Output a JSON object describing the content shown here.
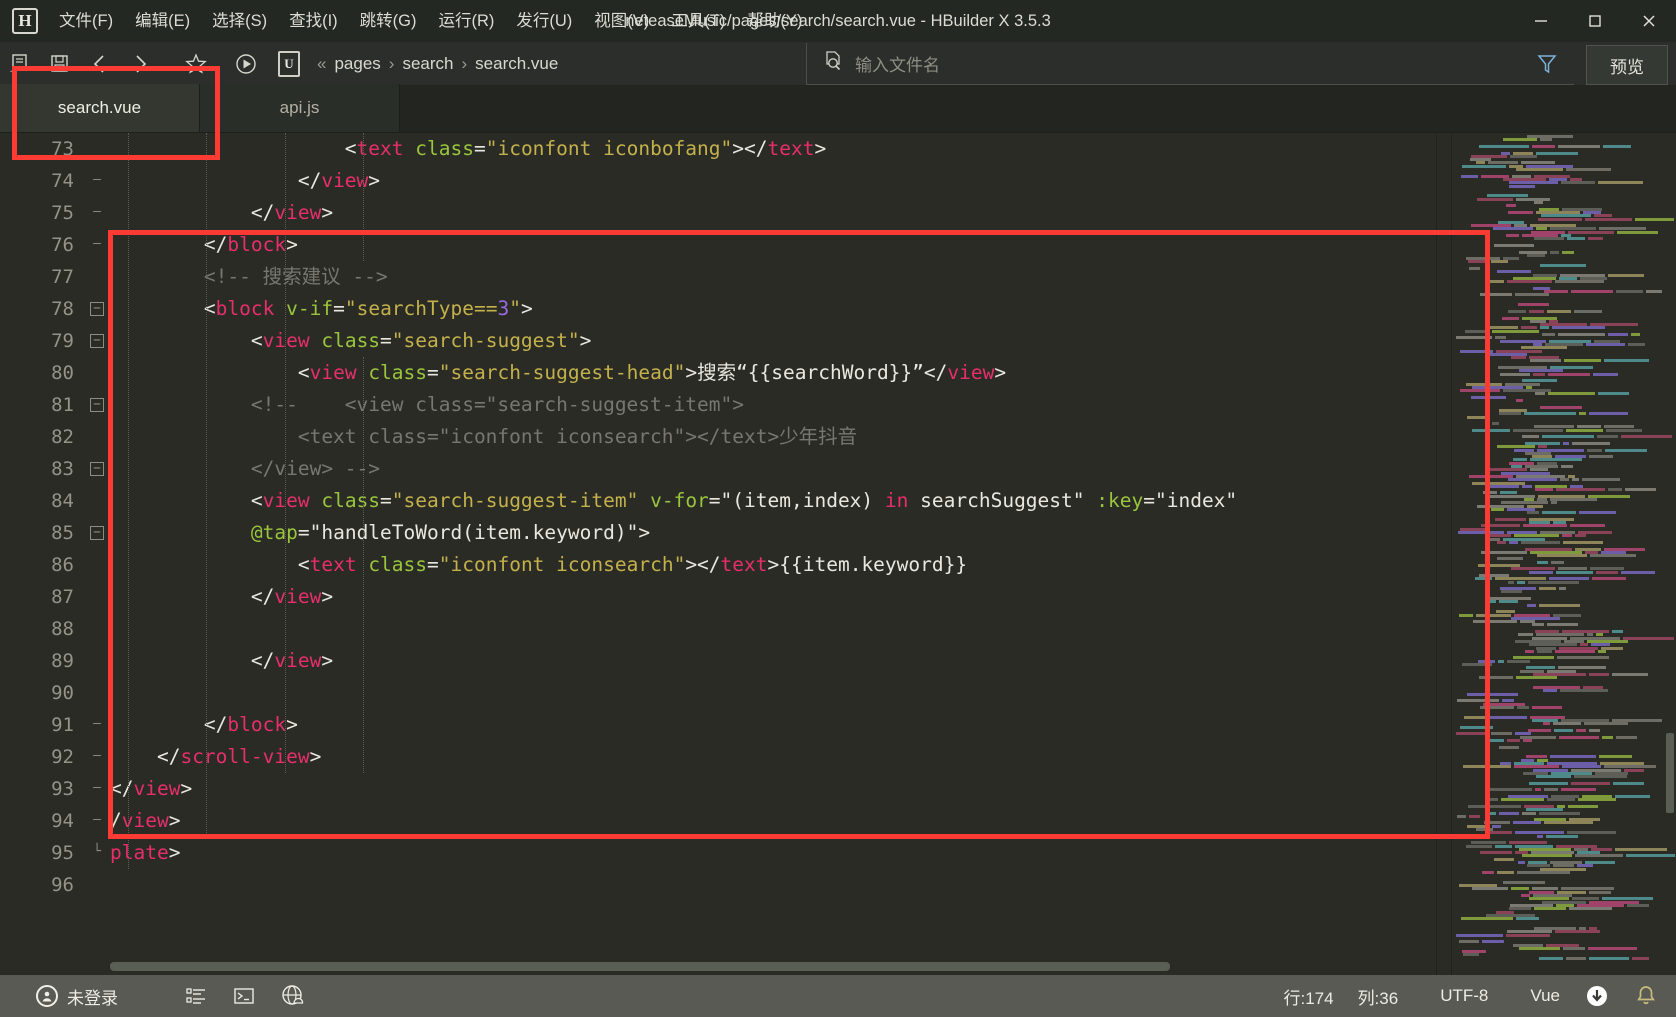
{
  "window": {
    "title": "neteaseMusic/pages/search/search.vue - HBuilder X 3.5.3",
    "logo_letter": "H",
    "minimize": "─",
    "maximize": "☐",
    "close": "✕"
  },
  "menubar": {
    "items": [
      {
        "label": "文件(F)",
        "name": "menu-file"
      },
      {
        "label": "编辑(E)",
        "name": "menu-edit"
      },
      {
        "label": "选择(S)",
        "name": "menu-select"
      },
      {
        "label": "查找(I)",
        "name": "menu-find"
      },
      {
        "label": "跳转(G)",
        "name": "menu-goto"
      },
      {
        "label": "运行(R)",
        "name": "menu-run"
      },
      {
        "label": "发行(U)",
        "name": "menu-publish"
      },
      {
        "label": "视图(V)",
        "name": "menu-view"
      },
      {
        "label": "工具(T)",
        "name": "menu-tools"
      },
      {
        "label": "帮助(Y)",
        "name": "menu-help"
      }
    ]
  },
  "toolbar": {
    "icons": [
      "new-file-icon",
      "save-icon",
      "back-arrow-icon",
      "forward-arrow-icon",
      "star-icon",
      "run-icon"
    ],
    "breadcrumb": {
      "project_logo": "U",
      "chevron": "«",
      "separator": "›",
      "items": [
        "pages",
        "search",
        "search.vue"
      ]
    },
    "file_search_placeholder": "输入文件名",
    "file_search_value": "",
    "preview_label": "预览"
  },
  "tabs": [
    {
      "label": "search.vue",
      "active": true
    },
    {
      "label": "api.js",
      "active": false
    }
  ],
  "editor": {
    "first_line": 73,
    "line_numbers": [
      73,
      74,
      75,
      76,
      77,
      78,
      79,
      80,
      81,
      82,
      83,
      84,
      85,
      86,
      87,
      88,
      89,
      90,
      91,
      92,
      93,
      94,
      95,
      96
    ],
    "lines": [
      {
        "n": 73,
        "fold": "",
        "indent": 0,
        "tokens": [
          {
            "t": "punc",
            "v": "                    <"
          },
          {
            "t": "tag",
            "v": "text"
          },
          {
            "t": "txt",
            "v": " "
          },
          {
            "t": "attr",
            "v": "class"
          },
          {
            "t": "punc",
            "v": "="
          },
          {
            "t": "str",
            "v": "\"iconfont iconbofang\""
          },
          {
            "t": "punc",
            "v": "></"
          },
          {
            "t": "tag",
            "v": "text"
          },
          {
            "t": "punc",
            "v": ">"
          }
        ]
      },
      {
        "n": 74,
        "fold": "dash",
        "indent": 0,
        "tokens": [
          {
            "t": "punc",
            "v": "                </"
          },
          {
            "t": "tag",
            "v": "view"
          },
          {
            "t": "punc",
            "v": ">"
          }
        ]
      },
      {
        "n": 75,
        "fold": "dash",
        "indent": 0,
        "tokens": [
          {
            "t": "punc",
            "v": "            </"
          },
          {
            "t": "tag",
            "v": "view"
          },
          {
            "t": "punc",
            "v": ">"
          }
        ]
      },
      {
        "n": 76,
        "fold": "dash",
        "indent": 0,
        "tokens": [
          {
            "t": "punc",
            "v": "        </"
          },
          {
            "t": "tag",
            "v": "block"
          },
          {
            "t": "punc",
            "v": ">"
          }
        ]
      },
      {
        "n": 77,
        "fold": "",
        "indent": 0,
        "tokens": [
          {
            "t": "cmt",
            "v": "        <!-- 搜索建议 -->"
          }
        ]
      },
      {
        "n": 78,
        "fold": "box",
        "indent": 0,
        "tokens": [
          {
            "t": "punc",
            "v": "        <"
          },
          {
            "t": "tag",
            "v": "block"
          },
          {
            "t": "txt",
            "v": " "
          },
          {
            "t": "attr",
            "v": "v-if"
          },
          {
            "t": "punc",
            "v": "="
          },
          {
            "t": "str",
            "v": "\"searchType=="
          },
          {
            "t": "num",
            "v": "3"
          },
          {
            "t": "str",
            "v": "\""
          },
          {
            "t": "punc",
            "v": ">"
          }
        ]
      },
      {
        "n": 79,
        "fold": "box",
        "indent": 0,
        "tokens": [
          {
            "t": "punc",
            "v": "            <"
          },
          {
            "t": "tag",
            "v": "view"
          },
          {
            "t": "txt",
            "v": " "
          },
          {
            "t": "attr",
            "v": "class"
          },
          {
            "t": "punc",
            "v": "="
          },
          {
            "t": "str",
            "v": "\"search-suggest\""
          },
          {
            "t": "punc",
            "v": ">"
          }
        ]
      },
      {
        "n": 80,
        "fold": "",
        "indent": 0,
        "tokens": [
          {
            "t": "punc",
            "v": "                <"
          },
          {
            "t": "tag",
            "v": "view"
          },
          {
            "t": "txt",
            "v": " "
          },
          {
            "t": "attr",
            "v": "class"
          },
          {
            "t": "punc",
            "v": "="
          },
          {
            "t": "str",
            "v": "\"search-suggest-head\""
          },
          {
            "t": "punc",
            "v": ">"
          },
          {
            "t": "txt",
            "v": "搜索“{{searchWord}}”"
          },
          {
            "t": "punc",
            "v": "</"
          },
          {
            "t": "tag",
            "v": "view"
          },
          {
            "t": "punc",
            "v": ">"
          }
        ]
      },
      {
        "n": 81,
        "fold": "box",
        "indent": 0,
        "tokens": [
          {
            "t": "cmt",
            "v": "            <!--    <view class=\"search-suggest-item\">"
          }
        ]
      },
      {
        "n": 82,
        "fold": "",
        "indent": 0,
        "tokens": [
          {
            "t": "cmt",
            "v": "                <text class=\"iconfont iconsearch\"></text>少年抖音"
          }
        ]
      },
      {
        "n": 83,
        "fold": "box",
        "indent": 0,
        "tokens": [
          {
            "t": "cmt",
            "v": "            </view> -->"
          }
        ]
      },
      {
        "n": 84,
        "fold": "",
        "indent": 0,
        "tokens": [
          {
            "t": "punc",
            "v": "            <"
          },
          {
            "t": "tag",
            "v": "view"
          },
          {
            "t": "txt",
            "v": " "
          },
          {
            "t": "attr",
            "v": "class"
          },
          {
            "t": "punc",
            "v": "="
          },
          {
            "t": "str",
            "v": "\"search-suggest-item\""
          },
          {
            "t": "txt",
            "v": " "
          },
          {
            "t": "attr",
            "v": "v-for"
          },
          {
            "t": "punc",
            "v": "="
          },
          {
            "t": "txt",
            "v": "\"(item,index) "
          },
          {
            "t": "kw",
            "v": "in"
          },
          {
            "t": "txt",
            "v": " searchSuggest\""
          },
          {
            "t": "txt",
            "v": " "
          },
          {
            "t": "attr",
            "v": ":key"
          },
          {
            "t": "punc",
            "v": "="
          },
          {
            "t": "txt",
            "v": "\"index\""
          }
        ]
      },
      {
        "n": 85,
        "fold": "box",
        "indent": 0,
        "tokens": [
          {
            "t": "punc",
            "v": "            "
          },
          {
            "t": "attr",
            "v": "@tap"
          },
          {
            "t": "punc",
            "v": "="
          },
          {
            "t": "txt",
            "v": "\"handleToWord(item.keyword)\""
          },
          {
            "t": "punc",
            "v": ">"
          }
        ]
      },
      {
        "n": 86,
        "fold": "",
        "indent": 0,
        "tokens": [
          {
            "t": "punc",
            "v": "                <"
          },
          {
            "t": "tag",
            "v": "text"
          },
          {
            "t": "txt",
            "v": " "
          },
          {
            "t": "attr",
            "v": "class"
          },
          {
            "t": "punc",
            "v": "="
          },
          {
            "t": "str",
            "v": "\"iconfont iconsearch\""
          },
          {
            "t": "punc",
            "v": "></"
          },
          {
            "t": "tag",
            "v": "text"
          },
          {
            "t": "punc",
            "v": ">"
          },
          {
            "t": "txt",
            "v": "{{item.keyword}}"
          }
        ]
      },
      {
        "n": 87,
        "fold": "",
        "indent": 0,
        "tokens": [
          {
            "t": "punc",
            "v": "            </"
          },
          {
            "t": "tag",
            "v": "view"
          },
          {
            "t": "punc",
            "v": ">"
          }
        ]
      },
      {
        "n": 88,
        "fold": "",
        "indent": 0,
        "tokens": []
      },
      {
        "n": 89,
        "fold": "",
        "indent": 0,
        "tokens": [
          {
            "t": "punc",
            "v": "            </"
          },
          {
            "t": "tag",
            "v": "view"
          },
          {
            "t": "punc",
            "v": ">"
          }
        ]
      },
      {
        "n": 90,
        "fold": "",
        "indent": 0,
        "tokens": []
      },
      {
        "n": 91,
        "fold": "dash",
        "indent": 0,
        "tokens": [
          {
            "t": "punc",
            "v": "        </"
          },
          {
            "t": "tag",
            "v": "block"
          },
          {
            "t": "punc",
            "v": ">"
          }
        ]
      },
      {
        "n": 92,
        "fold": "dash",
        "indent": 0,
        "tokens": [
          {
            "t": "punc",
            "v": "    </"
          },
          {
            "t": "tag",
            "v": "scroll-view"
          },
          {
            "t": "punc",
            "v": ">"
          }
        ]
      },
      {
        "n": 93,
        "fold": "dash",
        "indent": 0,
        "tokens": [
          {
            "t": "punc",
            "v": "</"
          },
          {
            "t": "tag",
            "v": "view"
          },
          {
            "t": "punc",
            "v": ">"
          }
        ]
      },
      {
        "n": 94,
        "fold": "dash",
        "indent": 0,
        "tokens": [
          {
            "t": "punc",
            "v": "/"
          },
          {
            "t": "tag",
            "v": "view"
          },
          {
            "t": "punc",
            "v": ">"
          }
        ]
      },
      {
        "n": 95,
        "fold": "endbox",
        "indent": 0,
        "tokens": [
          {
            "t": "tag",
            "v": "plate"
          },
          {
            "t": "punc",
            "v": ">"
          }
        ]
      },
      {
        "n": 96,
        "fold": "",
        "indent": 0,
        "tokens": []
      }
    ]
  },
  "statusbar": {
    "account": "未登录",
    "icons": [
      "account-icon",
      "outline-icon",
      "terminal-icon",
      "browser-icon",
      "download-icon",
      "bell-icon"
    ],
    "line_label": "行:174",
    "col_label": "列:36",
    "encoding": "UTF-8",
    "language": "Vue"
  },
  "annotations": {
    "boxes": [
      {
        "name": "tab-highlight",
        "color": "#fb3b34"
      },
      {
        "name": "code-block-highlight",
        "color": "#fb3b34"
      }
    ]
  },
  "colors": {
    "accent_red": "#fb3b34",
    "tag": "#e62e6b",
    "attr": "#99c63c",
    "string": "#c3b14b",
    "number": "#9a6ae0",
    "comment": "#777770",
    "editor_bg": "#2b2b26",
    "status_bg": "#5a5a55"
  }
}
